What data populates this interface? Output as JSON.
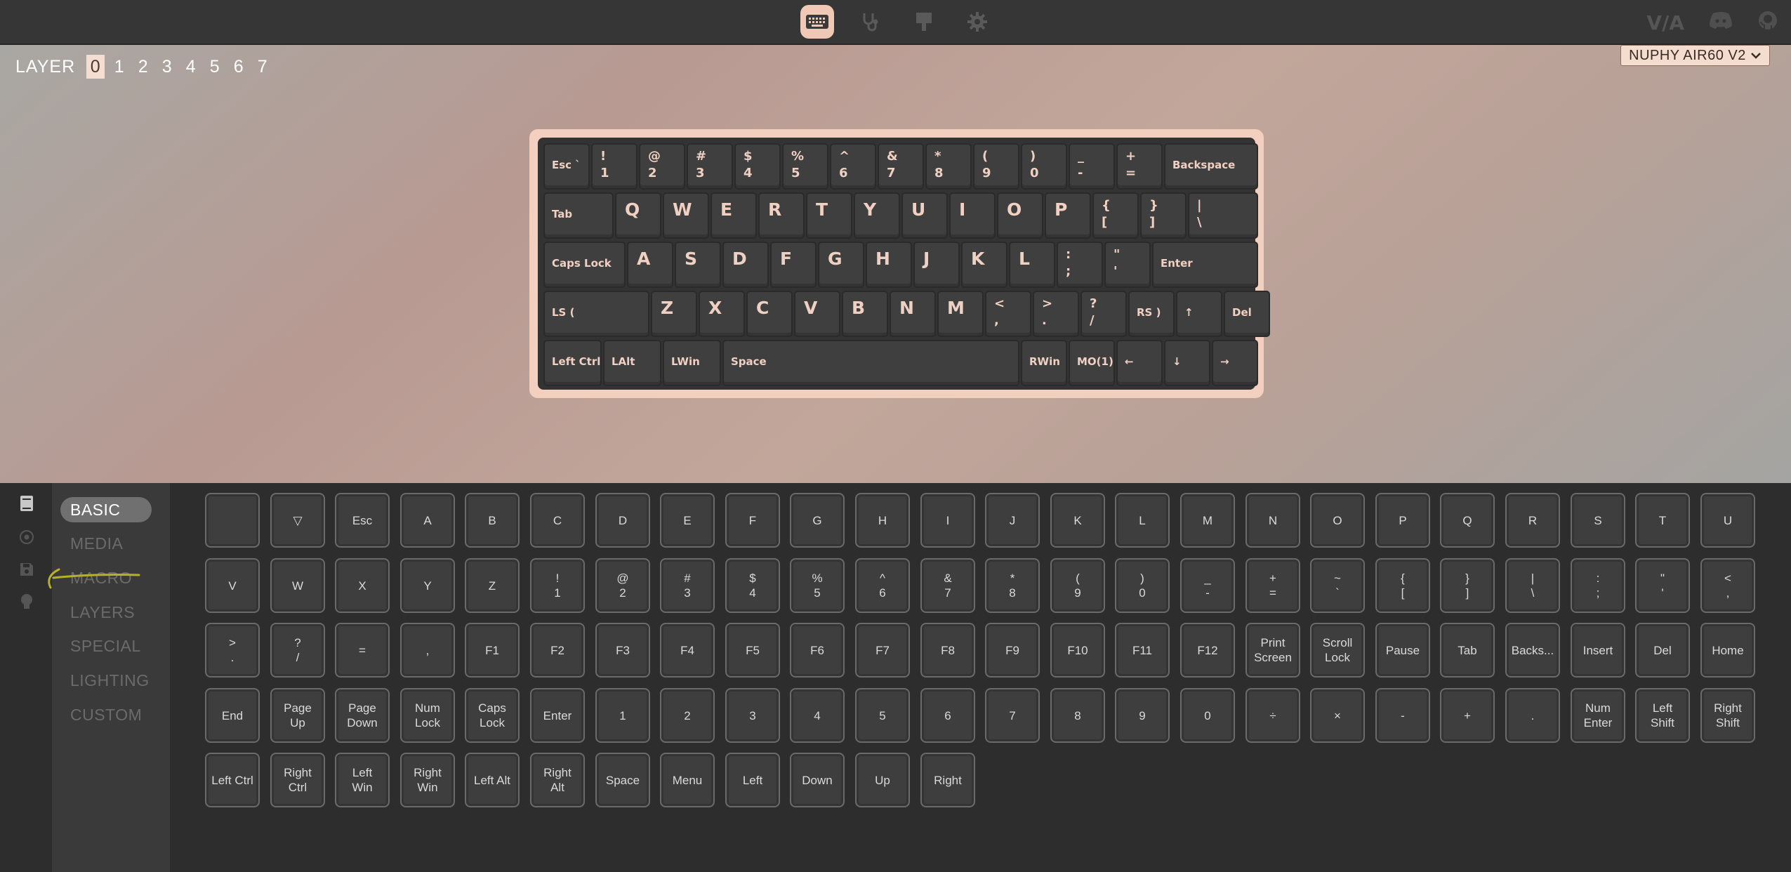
{
  "topbar": {
    "nav": [
      {
        "name": "keyboard-icon",
        "active": true
      },
      {
        "name": "stethoscope-icon",
        "active": false
      },
      {
        "name": "paintbrush-icon",
        "active": false
      },
      {
        "name": "gear-icon",
        "active": false
      }
    ],
    "right": {
      "via_logo": "V/A"
    }
  },
  "layers": {
    "label": "LAYER",
    "items": [
      "0",
      "1",
      "2",
      "3",
      "4",
      "5",
      "6",
      "7"
    ],
    "active": "0"
  },
  "keyboard_select": {
    "value": "NUPHY AIR60 V2"
  },
  "keyboard": {
    "rows": [
      [
        {
          "t": "Esc `"
        },
        {
          "u": "!",
          "d": "1"
        },
        {
          "u": "@",
          "d": "2"
        },
        {
          "u": "#",
          "d": "3"
        },
        {
          "u": "$",
          "d": "4"
        },
        {
          "u": "%",
          "d": "5"
        },
        {
          "u": "^",
          "d": "6"
        },
        {
          "u": "&",
          "d": "7"
        },
        {
          "u": "*",
          "d": "8"
        },
        {
          "u": "(",
          "d": "9"
        },
        {
          "u": ")",
          "d": "0"
        },
        {
          "u": "_",
          "d": "-"
        },
        {
          "u": "+",
          "d": "="
        },
        {
          "t": "Backspace"
        }
      ],
      [
        {
          "t": "Tab"
        },
        {
          "b": "Q"
        },
        {
          "b": "W"
        },
        {
          "b": "E"
        },
        {
          "b": "R"
        },
        {
          "b": "T"
        },
        {
          "b": "Y"
        },
        {
          "b": "U"
        },
        {
          "b": "I"
        },
        {
          "b": "O"
        },
        {
          "b": "P"
        },
        {
          "u": "{",
          "d": "["
        },
        {
          "u": "}",
          "d": "]"
        },
        {
          "u": "|",
          "d": "\\"
        }
      ],
      [
        {
          "t": "Caps Lock"
        },
        {
          "b": "A"
        },
        {
          "b": "S"
        },
        {
          "b": "D"
        },
        {
          "b": "F"
        },
        {
          "b": "G"
        },
        {
          "b": "H"
        },
        {
          "b": "J"
        },
        {
          "b": "K"
        },
        {
          "b": "L"
        },
        {
          "u": ":",
          "d": ";"
        },
        {
          "u": "\"",
          "d": "'"
        },
        {
          "t": "Enter"
        }
      ],
      [
        {
          "t": "LS ("
        },
        {
          "b": "Z"
        },
        {
          "b": "X"
        },
        {
          "b": "C"
        },
        {
          "b": "V"
        },
        {
          "b": "B"
        },
        {
          "b": "N"
        },
        {
          "b": "M"
        },
        {
          "u": "<",
          "d": ","
        },
        {
          "u": ">",
          "d": "."
        },
        {
          "u": "?",
          "d": "/"
        },
        {
          "t": "RS )"
        },
        {
          "t": "↑"
        },
        {
          "t": "Del"
        }
      ],
      [
        {
          "t": "Left Ctrl"
        },
        {
          "t": "LAlt"
        },
        {
          "t": "LWin"
        },
        {
          "t": "Space"
        },
        {
          "t": "RWin"
        },
        {
          "t": "MO(1)"
        },
        {
          "t": "←"
        },
        {
          "t": "↓"
        },
        {
          "t": "→"
        }
      ]
    ]
  },
  "sidebar": {
    "icons": [
      "book-icon",
      "target-icon",
      "save-icon",
      "lightbulb-icon"
    ],
    "menu": [
      "BASIC",
      "MEDIA",
      "MACRO",
      "LAYERS",
      "SPECIAL",
      "LIGHTING",
      "CUSTOM"
    ],
    "active": "BASIC"
  },
  "keycodes": [
    "",
    "▽",
    "Esc",
    "A",
    "B",
    "C",
    "D",
    "E",
    "F",
    "G",
    "H",
    "I",
    "J",
    "K",
    "L",
    "M",
    "N",
    "O",
    "P",
    "Q",
    "R",
    "S",
    "T",
    "U",
    "V",
    "W",
    "X",
    "Y",
    "Z",
    "!\n1",
    "@\n2",
    "#\n3",
    "$\n4",
    "%\n5",
    "^\n6",
    "&\n7",
    "*\n8",
    "(\n9",
    ")\n0",
    "_\n-",
    "+\n=",
    "~\n`",
    "{\n[",
    "}\n]",
    "|\n\\",
    ":\n;",
    "\"\n'",
    "<\n,",
    ">\n.",
    "?\n/",
    "=",
    ",",
    "F1",
    "F2",
    "F3",
    "F4",
    "F5",
    "F6",
    "F7",
    "F8",
    "F9",
    "F10",
    "F11",
    "F12",
    "Print\nScreen",
    "Scroll\nLock",
    "Pause",
    "Tab",
    "Backs...",
    "Insert",
    "Del",
    "Home",
    "End",
    "Page\nUp",
    "Page\nDown",
    "Num\nLock",
    "Caps\nLock",
    "Enter",
    "1",
    "2",
    "3",
    "4",
    "5",
    "6",
    "7",
    "8",
    "9",
    "0",
    "÷",
    "×",
    "-",
    "+",
    ".",
    "Num\nEnter",
    "Left\nShift",
    "Right\nShift",
    "Left Ctrl",
    "Right\nCtrl",
    "Left\nWin",
    "Right\nWin",
    "Left Alt",
    "Right\nAlt",
    "Space",
    "Menu",
    "Left",
    "Down",
    "Up",
    "Right"
  ]
}
